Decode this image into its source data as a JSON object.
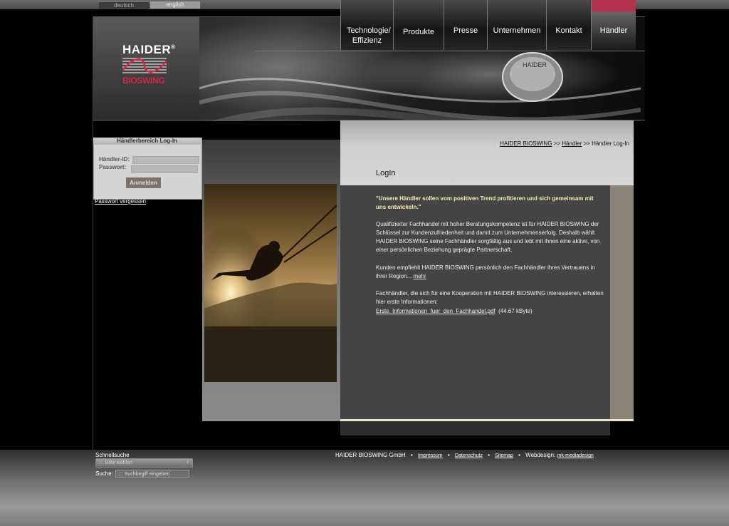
{
  "languages": [
    "deutsch",
    "english"
  ],
  "logo": {
    "line1": "HAIDER",
    "line2": "BIOSWING",
    "registered": "®",
    "accent": "#d8254a"
  },
  "nav": [
    {
      "label": "Technologie/ Effizienz"
    },
    {
      "label": "Produkte"
    },
    {
      "label": "Presse"
    },
    {
      "label": "Unternehmen"
    },
    {
      "label": "Kontakt"
    },
    {
      "label": "Händler",
      "active": true
    }
  ],
  "login": {
    "title": "Händlerbereich Log-In",
    "id_label": "Händler-ID:",
    "pw_label": "Passwort:",
    "button": "Anmelden",
    "forgot": "Passwort vergessen"
  },
  "breadcrumb": {
    "home": "HAIDER BIOSWING",
    "sep1": ">>",
    "section": "Händler",
    "sep2": ">>",
    "current": "Händler Log-In"
  },
  "content": {
    "title": "LogIn",
    "intro": "\"Unsere Händler sollen vom positiven Trend profitieren und sich gemeinsam mit uns entwickeln.\"",
    "p1": "Qualifizierter Fachhandel mit hoher Beratungskompetenz ist für HAIDER BIOSWING der Schlüssel zur Kundenzufriedenheit und damit zum Unternehmenserfolg. Deshalb wählt HAIDER BIOSWING seine Fachhändler sorgfältig aus und lebt mit ihnen eine aktive, von einer persönlichen Beziehung geprägte Partnerschaft.",
    "p2": "Kunden empfiehlt HAIDER BIOSWING persönlich den Fachhändler ihres Vertrauens in ihrer Region...",
    "p2_link": "mehr",
    "p3": "Fachhändler, die sich für eine Kooperation mit HAIDER BIOSWING interessieren, erhalten hier erste Informationen:",
    "pdf_link": "Erste_Informationen_fuer_den_Fachhandel.pdf",
    "pdf_size": "(44.67 kByte)"
  },
  "footer": {
    "quick_label": "Schnellsuche",
    "quick_placeholder": ":::: Bitte wählen",
    "search_label": "Suche:",
    "search_placeholder": ":::: Suchbegiff eingeben",
    "company": "HAIDER BIOSWING GmbH",
    "links": [
      "Impressum",
      "Datenschutz",
      "Sitemap"
    ],
    "webdesign_label": "Webdesign:",
    "webdesign_link": "mk-mediadesign"
  }
}
